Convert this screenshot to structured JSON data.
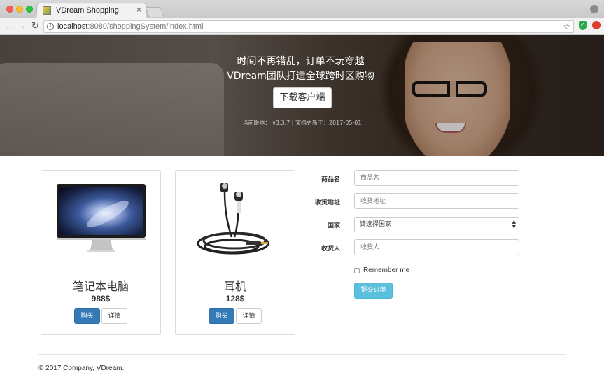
{
  "browser": {
    "tab_title": "VDream Shopping",
    "url_host": "localhost",
    "url_rest": ":8080/shoppingSystem/index.html"
  },
  "hero": {
    "line1": "时间不再错乱，订单不玩穿越",
    "line2": "VDream团队打造全球跨时区购物",
    "download_label": "下载客户端",
    "version_text": "当前版本： v3.3.7 | 文档更新于：2017-05-01"
  },
  "products": [
    {
      "name": "笔记本电脑",
      "price": "988$",
      "buy_label": "购买",
      "detail_label": "详情"
    },
    {
      "name": "耳机",
      "price": "128$",
      "buy_label": "购买",
      "detail_label": "详情"
    }
  ],
  "form": {
    "product_label": "商品名",
    "product_placeholder": "商品名",
    "address_label": "收货地址",
    "address_placeholder": "收货地址",
    "country_label": "国家",
    "country_selected": "请选择国家",
    "recipient_label": "收货人",
    "recipient_placeholder": "收货人",
    "remember_label": "Remember me",
    "submit_label": "提交订单"
  },
  "footer": {
    "text": "© 2017 Company, VDream."
  },
  "colors": {
    "primary": "#337ab7",
    "info": "#5bc0de"
  }
}
